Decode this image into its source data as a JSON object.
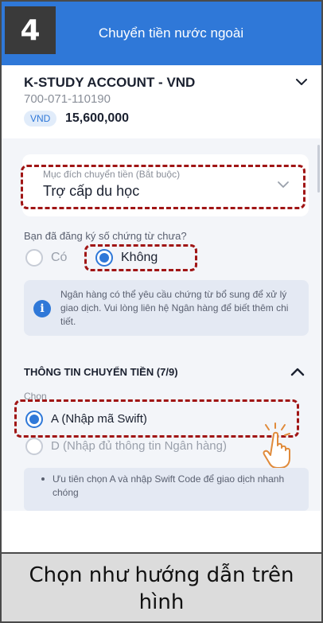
{
  "step": "4",
  "header": {
    "title": "Chuyển tiền nước ngoài"
  },
  "account": {
    "name": "K-STUDY ACCOUNT - VND",
    "number": "700-071-110190",
    "currency": "VND",
    "balance": "15,600,000"
  },
  "purpose": {
    "label": "Mục đích chuyển tiền (Bắt buộc)",
    "value": "Trợ cấp du học"
  },
  "document_question": {
    "label": "Bạn đã đăng ký số chứng từ chưa?",
    "options": [
      "Có",
      "Không"
    ],
    "selected": "Không"
  },
  "info": {
    "text": "Ngân hàng có thể yêu cầu chứng từ bổ sung để xử lý giao dịch. Vui lòng liên hệ Ngân hàng để biết thêm chi tiết."
  },
  "transfer_section": {
    "title": "THÔNG TIN CHUYỂN TIỀN (7/9)",
    "choose_label": "Chọn",
    "options": [
      "A (Nhập mã Swift)",
      "D (Nhập đủ thông tin Ngân hàng)"
    ],
    "selected": "A (Nhập mã Swift)",
    "note": "Ưu tiên chọn A và nhập Swift Code để giao dịch nhanh chóng"
  },
  "caption": "Chọn như hướng dẫn trên hình",
  "colors": {
    "primary": "#2f78d8",
    "highlight_border": "#a01515",
    "badge_bg": "#3a3a3a",
    "caption_bg": "#dcdcdc"
  }
}
